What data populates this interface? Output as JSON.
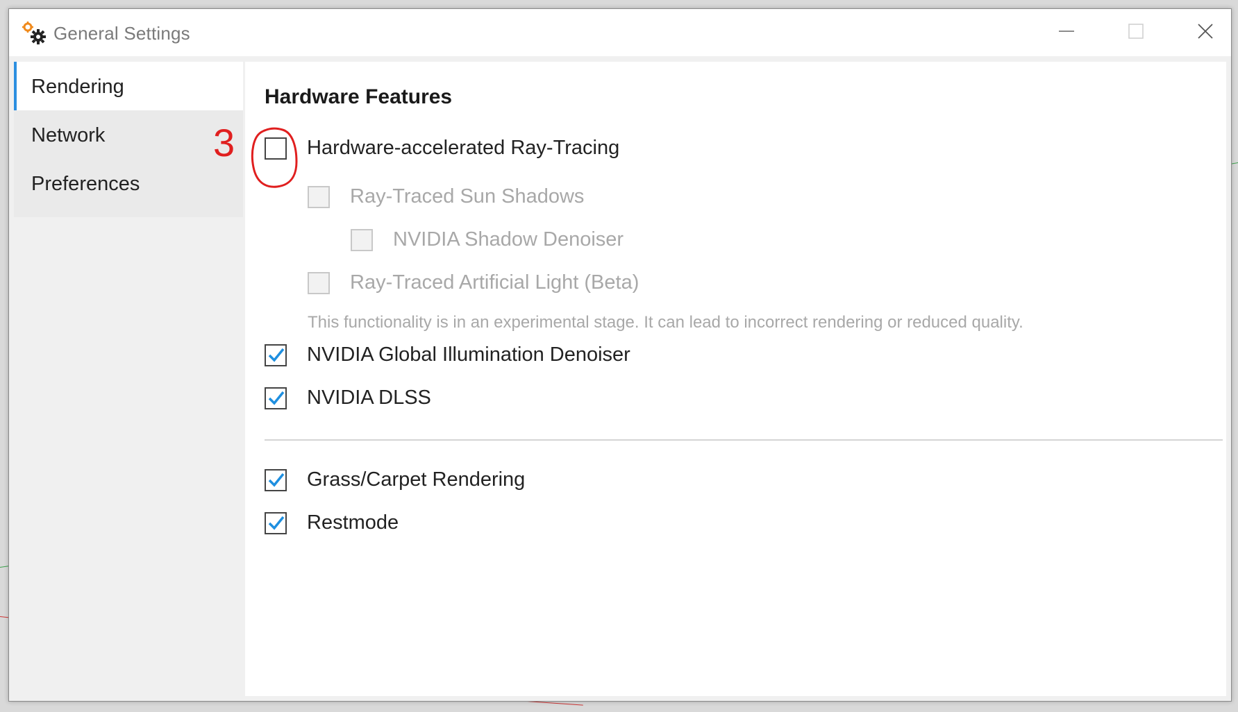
{
  "window": {
    "title": "General Settings",
    "icon": "gears-icon",
    "controls": [
      "minimize",
      "maximize",
      "close"
    ]
  },
  "sidebar": {
    "items": [
      {
        "label": "Rendering",
        "active": true
      },
      {
        "label": "Network",
        "active": false
      },
      {
        "label": "Preferences",
        "active": false
      }
    ]
  },
  "content": {
    "section_title": "Hardware Features",
    "options": [
      {
        "label": "Hardware-accelerated Ray-Tracing",
        "checked": false,
        "enabled": true
      },
      {
        "label": "Ray-Traced Sun Shadows",
        "checked": false,
        "enabled": false
      },
      {
        "label": "NVIDIA Shadow Denoiser",
        "checked": false,
        "enabled": false
      },
      {
        "label": "Ray-Traced Artificial Light (Beta)",
        "checked": false,
        "enabled": false
      },
      {
        "label": "NVIDIA Global Illumination Denoiser",
        "checked": true,
        "enabled": true
      },
      {
        "label": "NVIDIA DLSS",
        "checked": true,
        "enabled": true
      },
      {
        "label": "Grass/Carpet Rendering",
        "checked": true,
        "enabled": true
      },
      {
        "label": "Restmode",
        "checked": true,
        "enabled": true
      }
    ],
    "experimental_note": "This functionality is in an experimental stage. It can lead to incorrect rendering or reduced quality."
  },
  "annotation": {
    "number": "3",
    "color": "#e01f1f"
  },
  "colors": {
    "accent": "#2c8fe0",
    "check": "#1e8fe0"
  }
}
